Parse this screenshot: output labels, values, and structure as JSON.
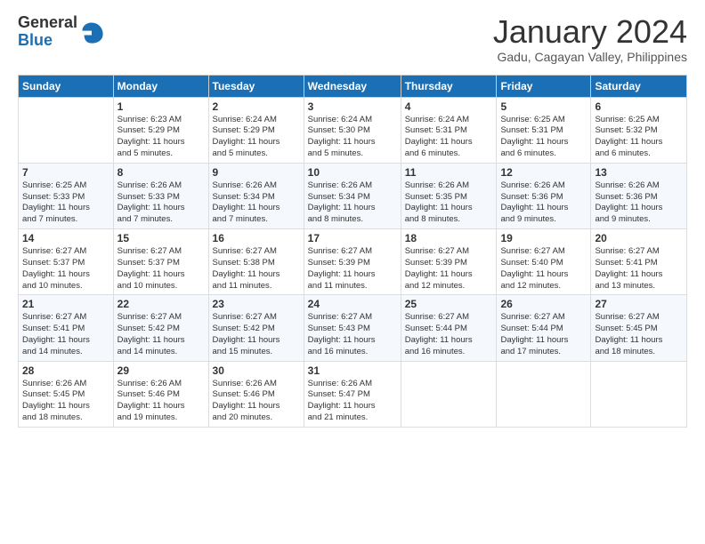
{
  "header": {
    "logo_line1": "General",
    "logo_line2": "Blue",
    "month": "January 2024",
    "location": "Gadu, Cagayan Valley, Philippines"
  },
  "days_of_week": [
    "Sunday",
    "Monday",
    "Tuesday",
    "Wednesday",
    "Thursday",
    "Friday",
    "Saturday"
  ],
  "weeks": [
    [
      {
        "num": "",
        "info": ""
      },
      {
        "num": "1",
        "info": "Sunrise: 6:23 AM\nSunset: 5:29 PM\nDaylight: 11 hours\nand 5 minutes."
      },
      {
        "num": "2",
        "info": "Sunrise: 6:24 AM\nSunset: 5:29 PM\nDaylight: 11 hours\nand 5 minutes."
      },
      {
        "num": "3",
        "info": "Sunrise: 6:24 AM\nSunset: 5:30 PM\nDaylight: 11 hours\nand 5 minutes."
      },
      {
        "num": "4",
        "info": "Sunrise: 6:24 AM\nSunset: 5:31 PM\nDaylight: 11 hours\nand 6 minutes."
      },
      {
        "num": "5",
        "info": "Sunrise: 6:25 AM\nSunset: 5:31 PM\nDaylight: 11 hours\nand 6 minutes."
      },
      {
        "num": "6",
        "info": "Sunrise: 6:25 AM\nSunset: 5:32 PM\nDaylight: 11 hours\nand 6 minutes."
      }
    ],
    [
      {
        "num": "7",
        "info": "Sunrise: 6:25 AM\nSunset: 5:33 PM\nDaylight: 11 hours\nand 7 minutes."
      },
      {
        "num": "8",
        "info": "Sunrise: 6:26 AM\nSunset: 5:33 PM\nDaylight: 11 hours\nand 7 minutes."
      },
      {
        "num": "9",
        "info": "Sunrise: 6:26 AM\nSunset: 5:34 PM\nDaylight: 11 hours\nand 7 minutes."
      },
      {
        "num": "10",
        "info": "Sunrise: 6:26 AM\nSunset: 5:34 PM\nDaylight: 11 hours\nand 8 minutes."
      },
      {
        "num": "11",
        "info": "Sunrise: 6:26 AM\nSunset: 5:35 PM\nDaylight: 11 hours\nand 8 minutes."
      },
      {
        "num": "12",
        "info": "Sunrise: 6:26 AM\nSunset: 5:36 PM\nDaylight: 11 hours\nand 9 minutes."
      },
      {
        "num": "13",
        "info": "Sunrise: 6:26 AM\nSunset: 5:36 PM\nDaylight: 11 hours\nand 9 minutes."
      }
    ],
    [
      {
        "num": "14",
        "info": "Sunrise: 6:27 AM\nSunset: 5:37 PM\nDaylight: 11 hours\nand 10 minutes."
      },
      {
        "num": "15",
        "info": "Sunrise: 6:27 AM\nSunset: 5:37 PM\nDaylight: 11 hours\nand 10 minutes."
      },
      {
        "num": "16",
        "info": "Sunrise: 6:27 AM\nSunset: 5:38 PM\nDaylight: 11 hours\nand 11 minutes."
      },
      {
        "num": "17",
        "info": "Sunrise: 6:27 AM\nSunset: 5:39 PM\nDaylight: 11 hours\nand 11 minutes."
      },
      {
        "num": "18",
        "info": "Sunrise: 6:27 AM\nSunset: 5:39 PM\nDaylight: 11 hours\nand 12 minutes."
      },
      {
        "num": "19",
        "info": "Sunrise: 6:27 AM\nSunset: 5:40 PM\nDaylight: 11 hours\nand 12 minutes."
      },
      {
        "num": "20",
        "info": "Sunrise: 6:27 AM\nSunset: 5:41 PM\nDaylight: 11 hours\nand 13 minutes."
      }
    ],
    [
      {
        "num": "21",
        "info": "Sunrise: 6:27 AM\nSunset: 5:41 PM\nDaylight: 11 hours\nand 14 minutes."
      },
      {
        "num": "22",
        "info": "Sunrise: 6:27 AM\nSunset: 5:42 PM\nDaylight: 11 hours\nand 14 minutes."
      },
      {
        "num": "23",
        "info": "Sunrise: 6:27 AM\nSunset: 5:42 PM\nDaylight: 11 hours\nand 15 minutes."
      },
      {
        "num": "24",
        "info": "Sunrise: 6:27 AM\nSunset: 5:43 PM\nDaylight: 11 hours\nand 16 minutes."
      },
      {
        "num": "25",
        "info": "Sunrise: 6:27 AM\nSunset: 5:44 PM\nDaylight: 11 hours\nand 16 minutes."
      },
      {
        "num": "26",
        "info": "Sunrise: 6:27 AM\nSunset: 5:44 PM\nDaylight: 11 hours\nand 17 minutes."
      },
      {
        "num": "27",
        "info": "Sunrise: 6:27 AM\nSunset: 5:45 PM\nDaylight: 11 hours\nand 18 minutes."
      }
    ],
    [
      {
        "num": "28",
        "info": "Sunrise: 6:26 AM\nSunset: 5:45 PM\nDaylight: 11 hours\nand 18 minutes."
      },
      {
        "num": "29",
        "info": "Sunrise: 6:26 AM\nSunset: 5:46 PM\nDaylight: 11 hours\nand 19 minutes."
      },
      {
        "num": "30",
        "info": "Sunrise: 6:26 AM\nSunset: 5:46 PM\nDaylight: 11 hours\nand 20 minutes."
      },
      {
        "num": "31",
        "info": "Sunrise: 6:26 AM\nSunset: 5:47 PM\nDaylight: 11 hours\nand 21 minutes."
      },
      {
        "num": "",
        "info": ""
      },
      {
        "num": "",
        "info": ""
      },
      {
        "num": "",
        "info": ""
      }
    ]
  ]
}
